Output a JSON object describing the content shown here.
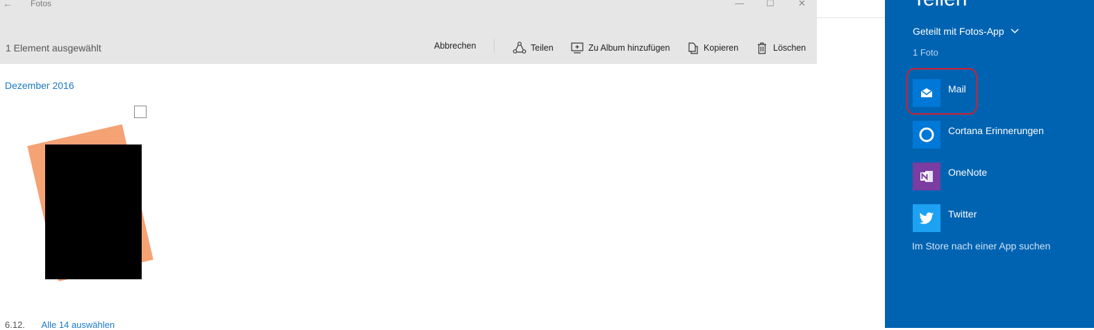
{
  "window": {
    "title": "Fotos",
    "back_icon": "arrow-left-icon"
  },
  "toolbar": {
    "selection_text": "1 Element ausgewählt",
    "cancel_label": "Abbrechen",
    "share_label": "Teilen",
    "add_album_label": "Zu Album hinzufügen",
    "copy_label": "Kopieren",
    "delete_label": "Löschen"
  },
  "content": {
    "month_label": "Dezember 2016",
    "footer_date": "6.12.",
    "footer_select_all": "Alle 14 auswählen"
  },
  "share_panel": {
    "title": "Teilen",
    "shared_with": "Geteilt mit Fotos-App",
    "count": "1 Foto",
    "apps": [
      {
        "label": "Mail",
        "icon": "mail-icon",
        "color": "#0078d7"
      },
      {
        "label": "Cortana Erinnerungen",
        "icon": "cortana-icon",
        "color": "#0078d7"
      },
      {
        "label": "OneNote",
        "icon": "onenote-icon",
        "color": "#7b3da1"
      },
      {
        "label": "Twitter",
        "icon": "twitter-icon",
        "color": "#1da1f2"
      }
    ],
    "store_link": "Im Store nach einer App suchen"
  },
  "colors": {
    "panel_bg": "#0063b1",
    "toolbar_bg": "#e6e6e6",
    "accent_link": "#1a79c7",
    "highlight": "#d41f2d"
  }
}
